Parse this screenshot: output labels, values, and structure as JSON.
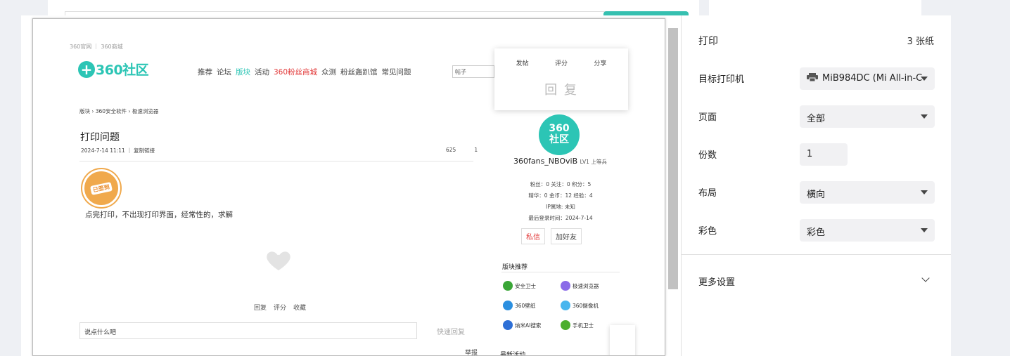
{
  "preview": {
    "top_links": "360官网 ｜ 360商城",
    "logo_text": "360社区",
    "nav": [
      "推荐",
      "论坛",
      "版块",
      "活动",
      "360粉丝商城",
      "众测",
      "粉丝轰趴馆",
      "常见问题"
    ],
    "search_value": "帖子",
    "float_card": {
      "actions": [
        "发帖",
        "评分",
        "分享"
      ],
      "reply_label": "回 复"
    },
    "breadcrumb": "版块 › 360安全软件 › 极速浏览器",
    "post": {
      "title": "打印问题",
      "meta": "2024-7-14 11:11  ｜  复制链接",
      "views": "625",
      "replies": "1",
      "badge": "已签到",
      "body": "点完打印，不出现打印界面，经常性的，求解",
      "actions": [
        "回复",
        "评分",
        "收藏"
      ],
      "comment_placeholder": "说点什么吧",
      "quick_reply": "快速回复",
      "report": "举报"
    },
    "user": {
      "avatar_text_1": "360",
      "avatar_text_2": "社区",
      "name": "360fans_NBOviB",
      "level": "LV1 上等兵",
      "stats_line1": "粉丝：0   关注：0   积分：5",
      "stats_line2": "精华：0   金币：12   经验：4",
      "ip": "IP属地: 未知",
      "last_login": "最后登录时间：2024-7-14",
      "btn_message": "私信",
      "btn_friend": "加好友"
    },
    "recommend": {
      "title": "版块推荐",
      "items": [
        {
          "label": "安全卫士",
          "color": "#3aa637"
        },
        {
          "label": "极速浏览器",
          "color": "#8b6be8"
        },
        {
          "label": "360壁纸",
          "color": "#2b8fe0"
        },
        {
          "label": "360摄像机",
          "color": "#49b6ee"
        },
        {
          "label": "纳米AI搜索",
          "color": "#2d6fd6"
        },
        {
          "label": "手机卫士",
          "color": "#4cae2e"
        }
      ]
    },
    "latest_title": "最新活动"
  },
  "panel": {
    "title": "打印",
    "sheets": "3 张纸",
    "printer_label": "目标打印机",
    "printer_value": "MiB984DC (Mi All-in-C",
    "pages_label": "页面",
    "pages_value": "全部",
    "copies_label": "份数",
    "copies_value": "1",
    "layout_label": "布局",
    "layout_value": "横向",
    "color_label": "彩色",
    "color_value": "彩色",
    "more_settings": "更多设置"
  }
}
